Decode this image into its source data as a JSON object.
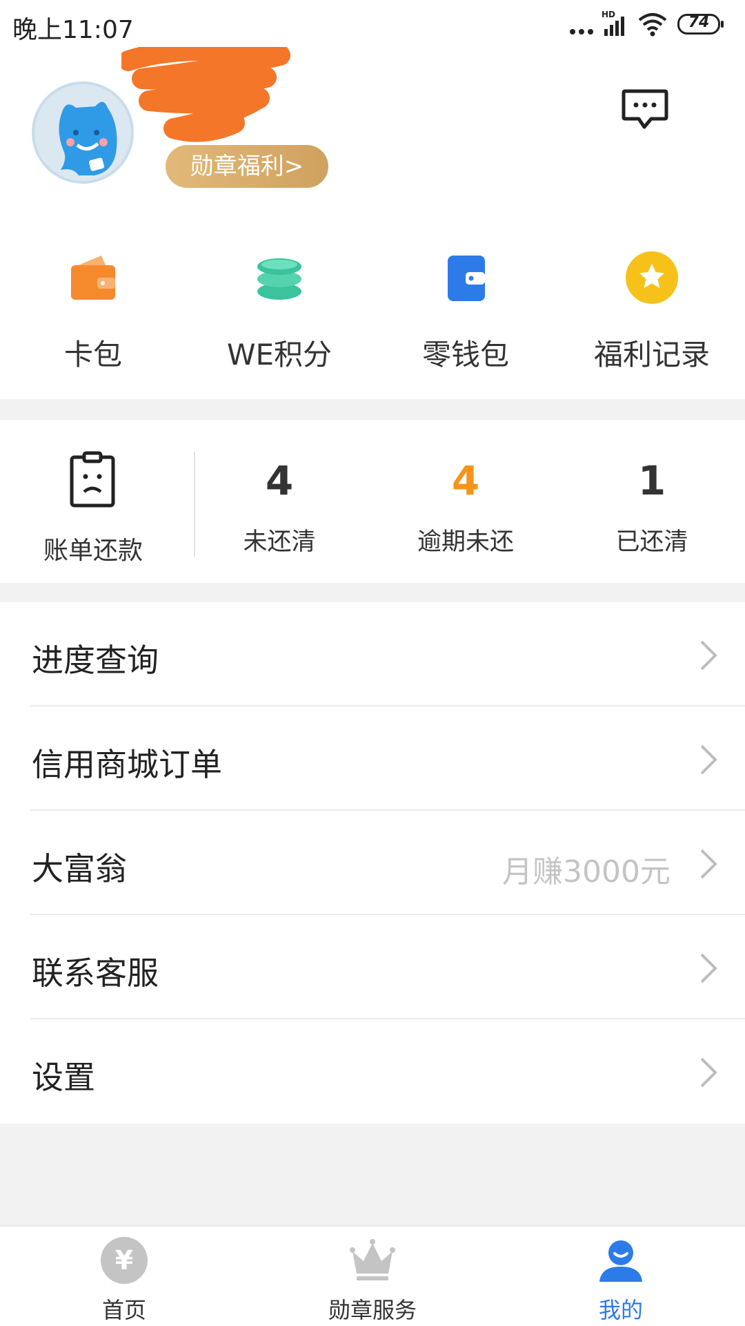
{
  "status_bar": {
    "time": "晚上11:07",
    "battery": "74",
    "network_label": "HD"
  },
  "profile": {
    "medal_badge": "勋章福利>"
  },
  "quick_actions": [
    {
      "label": "卡包",
      "icon": "wallet-icon",
      "color": "#f58a2d"
    },
    {
      "label": "WE积分",
      "icon": "coins-stack-icon",
      "color": "#3ac39c"
    },
    {
      "label": "零钱包",
      "icon": "purse-icon",
      "color": "#2d7be8"
    },
    {
      "label": "福利记录",
      "icon": "star-coin-icon",
      "color": "#f6c21a"
    }
  ],
  "bills": {
    "label": "账单还款",
    "stats": [
      {
        "value": "4",
        "label": "未还清"
      },
      {
        "value": "4",
        "label": "逾期未还",
        "highlight": "#f5941a"
      },
      {
        "value": "1",
        "label": "已还清"
      }
    ]
  },
  "menu": [
    {
      "label": "进度查询",
      "sub": ""
    },
    {
      "label": "信用商城订单",
      "sub": ""
    },
    {
      "label": "大富翁",
      "sub": "月赚3000元"
    },
    {
      "label": "联系客服",
      "sub": ""
    },
    {
      "label": "设置",
      "sub": ""
    }
  ],
  "bottom_nav": {
    "items": [
      {
        "label": "首页",
        "icon": "yen-icon"
      },
      {
        "label": "勋章服务",
        "icon": "crown-icon"
      },
      {
        "label": "我的",
        "icon": "user-icon",
        "active": true
      }
    ],
    "yen_symbol": "¥",
    "active_color": "#2d7be8"
  }
}
